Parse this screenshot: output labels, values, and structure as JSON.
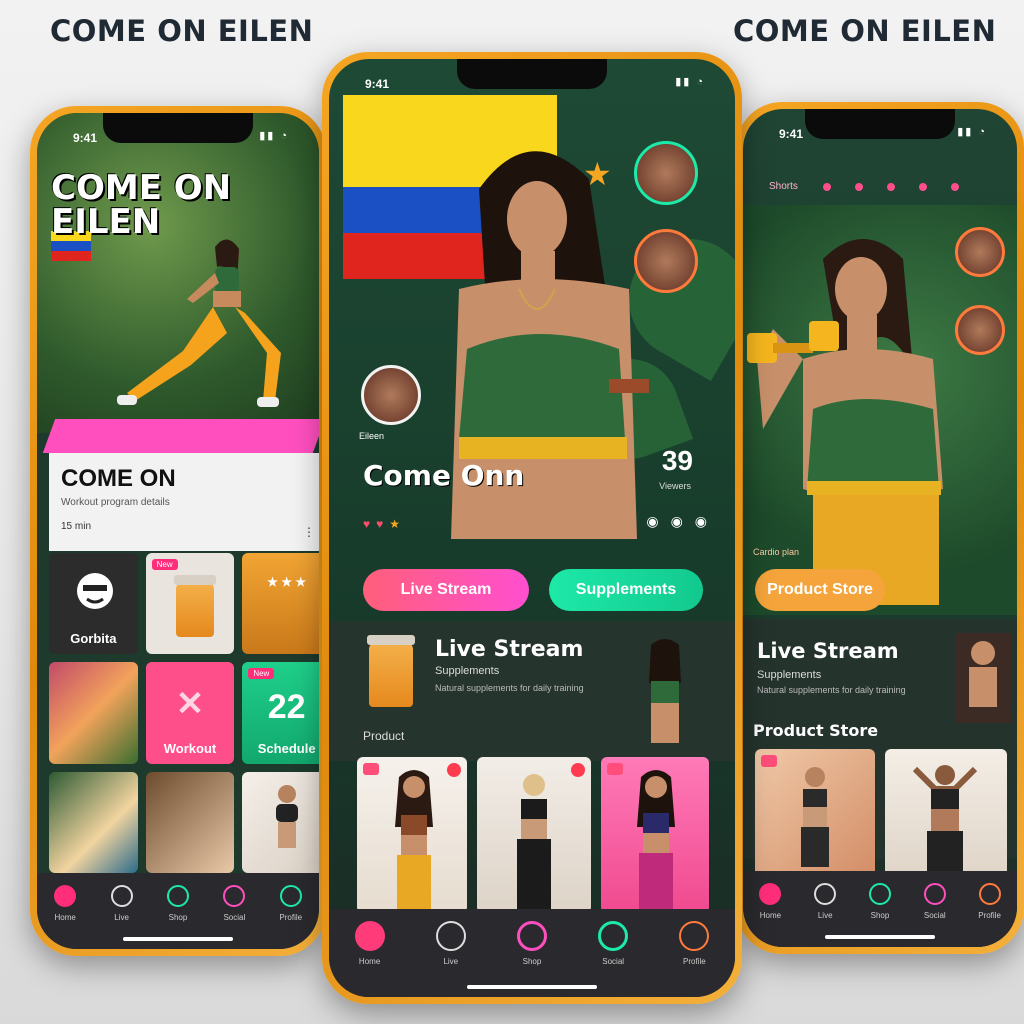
{
  "header": {
    "title_left": "COME ON EILEN",
    "title_right": "COME ON EILEN"
  },
  "colors": {
    "frame": "#f5a623",
    "accent_pink": "#ff4fa0",
    "accent_green": "#1de9a8",
    "accent_orange": "#f4a43a",
    "nav_bg": "#2a2a2e"
  },
  "left_phone": {
    "status_time": "9:41",
    "hero_title": "COME ON EILEN",
    "info_title": "COME ON",
    "info_sub": "Workout program details",
    "info_meta": "15 min",
    "tiles": [
      {
        "label": "Gorbita",
        "icon": "face-icon"
      },
      {
        "label": "",
        "icon": "supplement-jar-icon",
        "badge": "New"
      },
      {
        "label": "",
        "icon": "promo-text"
      },
      {
        "label": "",
        "icon": "photo"
      },
      {
        "label": "Workout",
        "icon": "x-icon"
      },
      {
        "label": "Schedule",
        "number": "22",
        "badge": "New"
      },
      {
        "label": "",
        "icon": "photo"
      },
      {
        "label": "",
        "icon": "photo"
      },
      {
        "label": "",
        "icon": "photo"
      }
    ],
    "nav": [
      {
        "label": "Home",
        "icon": "home-icon"
      },
      {
        "label": "Live",
        "icon": "live-icon"
      },
      {
        "label": "Shop",
        "icon": "shop-icon"
      },
      {
        "label": "Social",
        "icon": "social-icon"
      },
      {
        "label": "Profile",
        "icon": "profile-icon"
      }
    ]
  },
  "center_phone": {
    "status_time": "9:41",
    "hero_title": "Come Onn",
    "viewer_count": "39",
    "viewer_label": "Viewers",
    "avatar_label": "Eileen",
    "btn_live": "Live Stream",
    "btn_supp": "Supplements",
    "section_title": "Live Stream",
    "section_sub": "Supplements",
    "section_desc": "Natural supplements for daily training",
    "product_label": "Product",
    "nav": [
      {
        "label": "Home",
        "icon": "home-icon"
      },
      {
        "label": "Live",
        "icon": "live-icon"
      },
      {
        "label": "Shop",
        "icon": "shop-icon"
      },
      {
        "label": "Social",
        "icon": "social-icon"
      },
      {
        "label": "Profile",
        "icon": "profile-icon"
      }
    ]
  },
  "right_phone": {
    "status_time": "9:41",
    "top_label": "Shorts",
    "caption": "Cardio plan",
    "btn_product": "Product Store",
    "section_title": "Live Stream",
    "section_sub": "Supplements",
    "section_desc": "Natural supplements for daily training",
    "product_title": "Product Store",
    "nav": [
      {
        "label": "Home",
        "icon": "home-icon"
      },
      {
        "label": "Live",
        "icon": "live-icon"
      },
      {
        "label": "Shop",
        "icon": "shop-icon"
      },
      {
        "label": "Social",
        "icon": "social-icon"
      },
      {
        "label": "Profile",
        "icon": "profile-icon"
      }
    ]
  }
}
